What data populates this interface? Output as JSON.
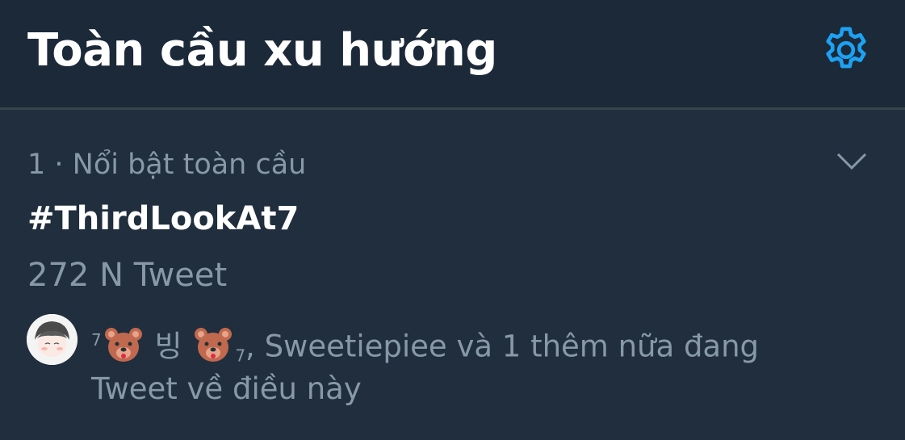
{
  "header": {
    "title": "Toàn cầu xu hướng",
    "settings_icon": "gear-icon",
    "accent_color": "#1da1f2"
  },
  "trend": {
    "rank_context": "1 · Nổi bật toàn cầu",
    "hashtag": "#ThirdLookAt7",
    "tweet_count": "272 N Tweet",
    "more_icon": "chevron-down-icon",
    "social_context": {
      "sup_prefix": "7",
      "user1_name": "빙",
      "sub_suffix": "7",
      "rest_line1": ", Sweetiepiee và 1 thêm nữa đang",
      "line2": "Tweet về điều này",
      "emoji_icon": "bear-face-icon"
    }
  },
  "colors": {
    "background": "#1c2938",
    "row_background": "#202e3d",
    "secondary_text": "#8899a6",
    "divider": "#38444d"
  }
}
